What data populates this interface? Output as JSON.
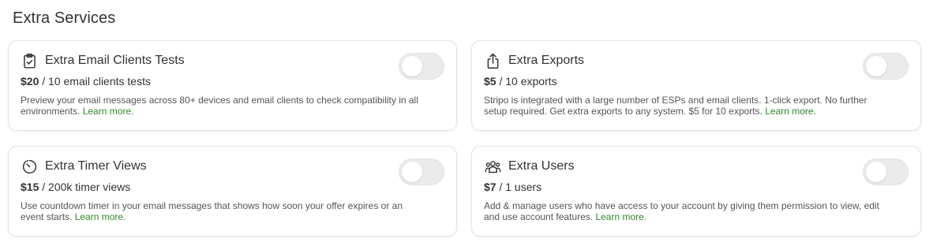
{
  "section": {
    "title": "Extra Services"
  },
  "accent_color": "#2e8b27",
  "services": [
    {
      "icon": "clipboard-check-icon",
      "title": "Extra Email Clients Tests",
      "price": "$20",
      "unit": " / 10 email clients tests",
      "description": "Preview your email messages across 80+ devices and email clients to check compatibility in all environments. ",
      "learn_more": "Learn more.",
      "enabled": false
    },
    {
      "icon": "share-upload-icon",
      "title": "Extra Exports",
      "price": "$5",
      "unit": " / 10 exports",
      "description": "Stripo is integrated with a large number of ESPs and email clients. 1-click export. No further setup required. Get extra exports to any system. $5 for 10 exports. ",
      "learn_more": "Learn more.",
      "enabled": false
    },
    {
      "icon": "timer-icon",
      "title": "Extra Timer Views",
      "price": "$15",
      "unit": " / 200k timer views",
      "description": "Use countdown timer in your email messages that shows how soon your offer expires or an event starts. ",
      "learn_more": "Learn more.",
      "enabled": false
    },
    {
      "icon": "users-icon",
      "title": "Extra Users",
      "price": "$7",
      "unit": " / 1 users",
      "description": "Add & manage users who have access to your account by giving them permission to view, edit and use account features. ",
      "learn_more": "Learn more.",
      "enabled": false
    }
  ]
}
